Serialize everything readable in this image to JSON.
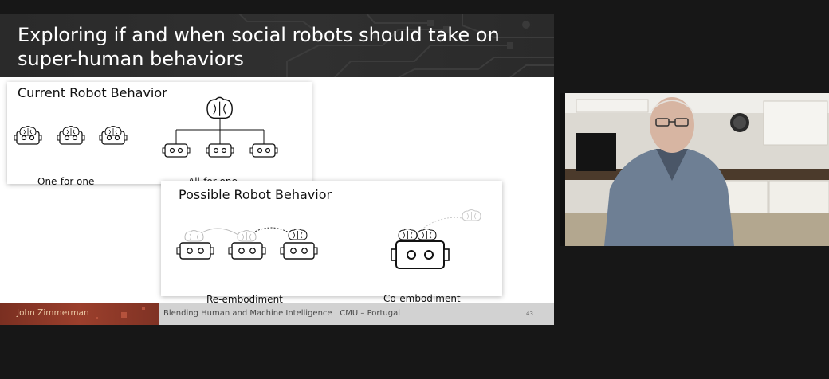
{
  "slide": {
    "title": "Exploring if and when social robots should take on super-human behaviors",
    "current_panel": {
      "title": "Current Robot Behavior",
      "captions": [
        "One-for-one",
        "All-for-one"
      ]
    },
    "possible_panel": {
      "title": "Possible Robot Behavior",
      "captions": [
        "Re-embodiment",
        "Co-embodiment"
      ]
    },
    "footer": {
      "presenter": "John Zimmerman",
      "course": "Blending Human and Machine Intelligence | CMU – Portugal",
      "page": "43"
    }
  },
  "icons": {
    "robot": "robot-icon",
    "brain": "brain-icon"
  },
  "colors": {
    "background": "#171717",
    "header": "#2d2d2d",
    "footer_accent": "#8e3a28",
    "footer_text": "#e9c6a3"
  }
}
